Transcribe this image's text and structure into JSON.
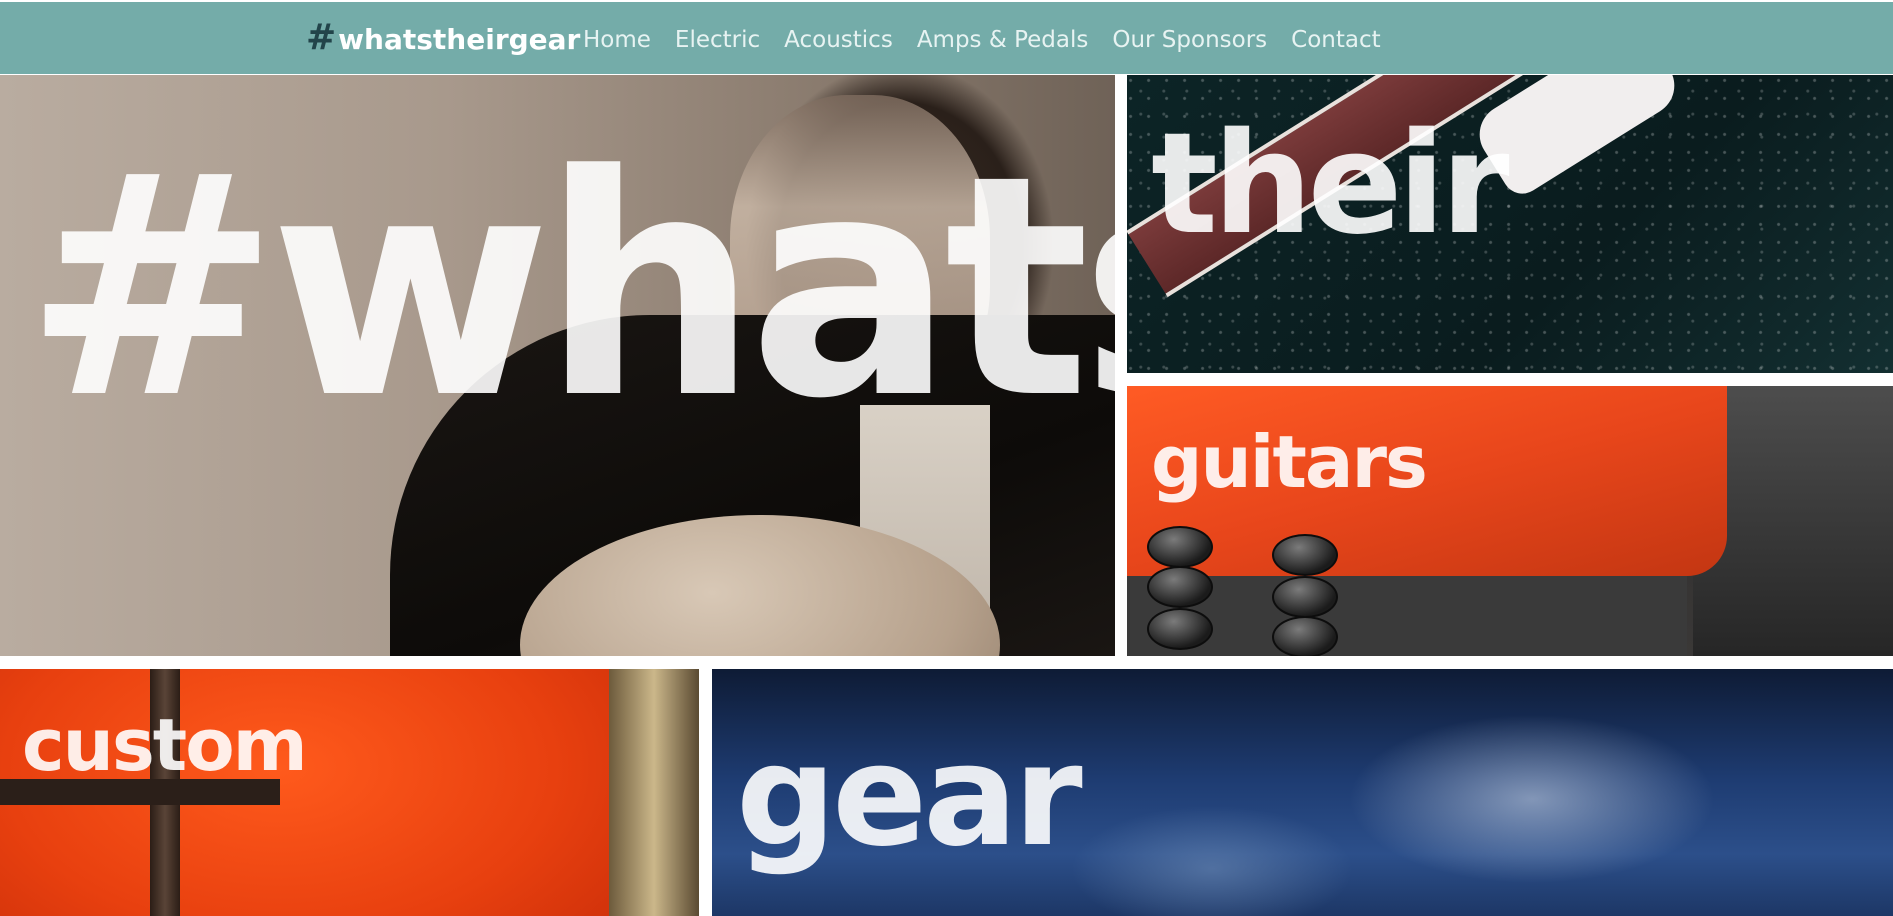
{
  "navbar": {
    "brand_hash": "#",
    "brand_text": "whatstheirgear",
    "links": [
      "Home",
      "Electric",
      "Acoustics",
      "Amps & Pedals",
      "Our Sponsors",
      "Contact"
    ],
    "background_color": "#74aca9"
  },
  "tiles": {
    "whats": {
      "word": "#whats"
    },
    "their": {
      "word": "their"
    },
    "guitars": {
      "word": "guitars"
    },
    "custom": {
      "word": "custom"
    },
    "gear": {
      "word": "gear"
    }
  }
}
